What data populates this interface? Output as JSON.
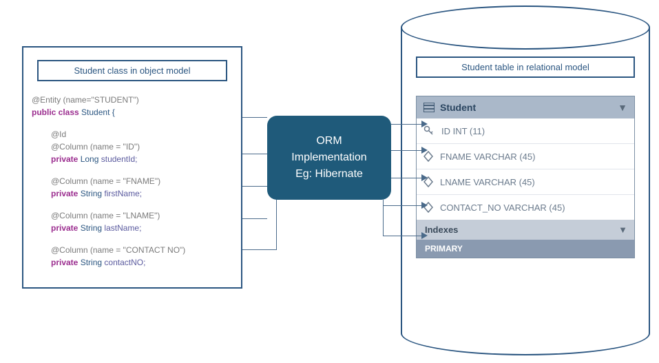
{
  "left_panel": {
    "title": "Student class in object model",
    "entity_annotation": "@Entity (name=\"STUDENT\")",
    "class_decl_keyword": "public class",
    "class_decl_name": "Student {",
    "fields": [
      {
        "annotations": [
          "@Id",
          "@Column (name = \"ID\")"
        ],
        "modifier": "private",
        "type": "Long",
        "name": "studentId;"
      },
      {
        "annotations": [
          "@Column (name = \"FNAME\")"
        ],
        "modifier": "private",
        "type": "String",
        "name": "firstName;"
      },
      {
        "annotations": [
          "@Column (name = \"LNAME\")"
        ],
        "modifier": "private",
        "type": "String",
        "name": "lastName;"
      },
      {
        "annotations": [
          "@Column (name = \"CONTACT NO\")"
        ],
        "modifier": "private",
        "type": "String",
        "name": "contactNO;"
      }
    ]
  },
  "orm_box": {
    "line1": "ORM",
    "line2": "Implementation",
    "line3": "Eg: Hibernate"
  },
  "right_panel": {
    "title": "Student table in relational model",
    "table_name": "Student",
    "columns": [
      {
        "icon": "key",
        "label": "ID INT (11)"
      },
      {
        "icon": "diamond",
        "label": "FNAME VARCHAR (45)"
      },
      {
        "icon": "diamond",
        "label": "LNAME VARCHAR (45)"
      },
      {
        "icon": "diamond",
        "label": "CONTACT_NO VARCHAR (45)"
      }
    ],
    "indexes_label": "Indexes",
    "primary_label": "PRIMARY"
  }
}
